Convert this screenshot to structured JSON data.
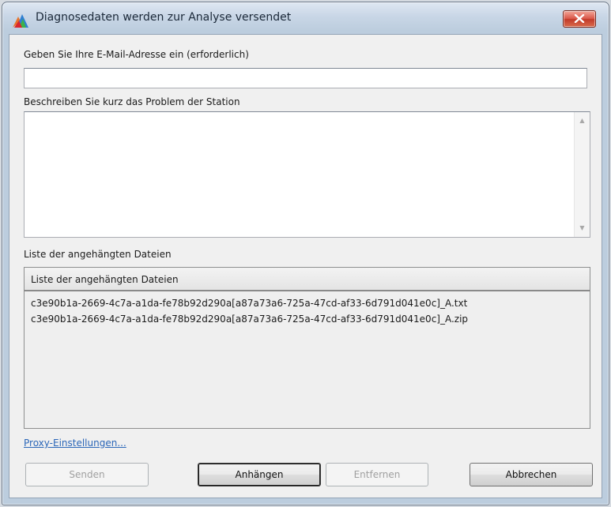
{
  "window": {
    "title": "Diagnosedaten werden zur Analyse versendet",
    "icon": "avg-logo-icon",
    "close_icon": "close-icon"
  },
  "form": {
    "email_label": "Geben Sie Ihre E-Mail-Adresse ein (erforderlich)",
    "email_value": "",
    "description_label": "Beschreiben Sie kurz das Problem der Station",
    "description_value": ""
  },
  "attachments": {
    "section_label": "Liste der angehängten Dateien",
    "column_header": "Liste der angehängten Dateien",
    "files": [
      "c3e90b1a-2669-4c7a-a1da-fe78b92d290a[a87a73a6-725a-47cd-af33-6d791d041e0c]_A.txt",
      "c3e90b1a-2669-4c7a-a1da-fe78b92d290a[a87a73a6-725a-47cd-af33-6d791d041e0c]_A.zip"
    ]
  },
  "links": {
    "proxy": "Proxy-Einstellungen..."
  },
  "buttons": {
    "send": "Senden",
    "attach": "Anhängen",
    "remove": "Entfernen",
    "cancel": "Abbrechen"
  },
  "colors": {
    "link": "#2a66b8",
    "close_button": "#c23a29",
    "disabled_text": "#a0a0a0"
  }
}
